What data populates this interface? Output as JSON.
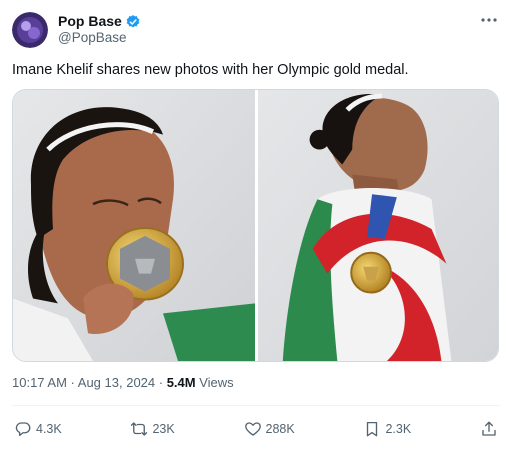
{
  "author": {
    "display_name": "Pop Base",
    "handle": "@PopBase",
    "verified_color": "#1d9bf0",
    "avatar_color": "#3b2a6b"
  },
  "more_icon": "more-horizontal-icon",
  "tweet": {
    "text": "Imane Khelif shares new photos with her Olympic gold medal."
  },
  "media": {
    "photos": [
      {
        "subject": "kissing-gold-medal-photo"
      },
      {
        "subject": "algerian-flag-medal-photo"
      }
    ]
  },
  "meta": {
    "time": "10:17 AM",
    "separator": " · ",
    "date": "Aug 13, 2024",
    "views_count": "5.4M",
    "views_label": " Views"
  },
  "actions": {
    "replies": "4.3K",
    "reposts": "23K",
    "likes": "288K",
    "bookmarks": "2.3K"
  },
  "colors": {
    "text_primary": "#0f1419",
    "text_secondary": "#536471",
    "divider": "#eff3f4"
  }
}
